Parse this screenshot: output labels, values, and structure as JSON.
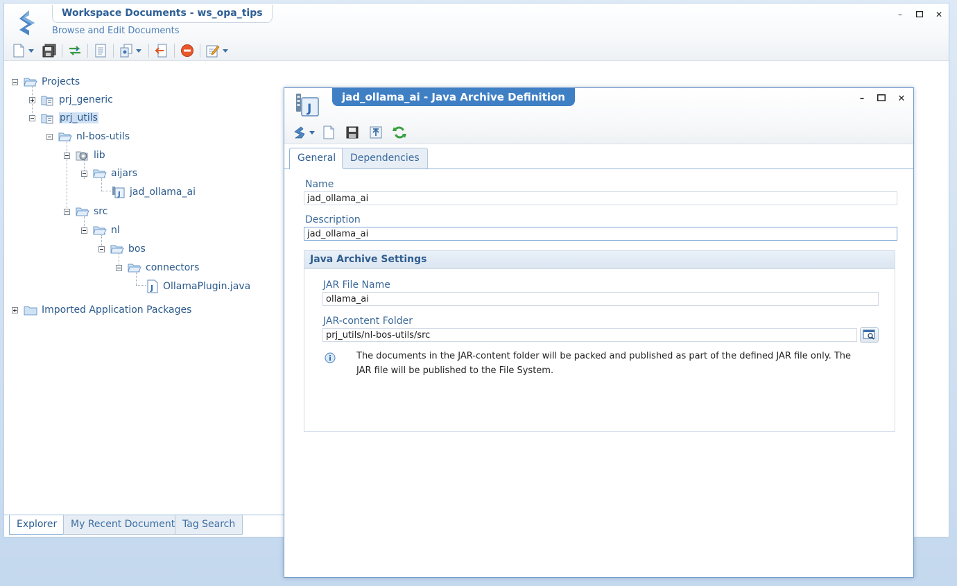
{
  "workspace": {
    "title": "Workspace Documents - ws_opa_tips",
    "subtitle": "Browse and Edit Documents"
  },
  "toolbar_icons": [
    "new-document-icon",
    "save-all-icon",
    "sync-icon",
    "document-icon",
    "copy-icon",
    "export-icon",
    "cancel-icon",
    "edit-icon"
  ],
  "tree": {
    "projects": "Projects",
    "prj_generic": "prj_generic",
    "prj_utils": "prj_utils",
    "nl_bos_utils": "nl-bos-utils",
    "lib": "lib",
    "aijars": "aijars",
    "jad_ollama_ai": "jad_ollama_ai",
    "src": "src",
    "nl": "nl",
    "bos": "bos",
    "connectors": "connectors",
    "ollama_plugin": "OllamaPlugin.java",
    "imported": "Imported Application Packages"
  },
  "bottom_tabs": {
    "explorer": "Explorer",
    "recent": "My Recent Documents",
    "tag_search": "Tag Search"
  },
  "dialog": {
    "title": "jad_ollama_ai - Java Archive Definition",
    "tabs": {
      "general": "General",
      "dependencies": "Dependencies"
    },
    "name_label": "Name",
    "name_value": "jad_ollama_ai",
    "description_label": "Description",
    "description_value": "jad_ollama_ai",
    "group_title": "Java Archive Settings",
    "jar_label": "JAR File Name",
    "jar_value": "ollama_ai",
    "folder_label": "JAR-content Folder",
    "folder_value": "prj_utils/nl-bos-utils/src",
    "info": "The documents in the JAR-content folder will be packed and published as part of the defined JAR file only. The JAR file will be published to the File System."
  },
  "colors": {
    "accent": "#3f7fc4",
    "link": "#2b5a8c",
    "selection": "#cfe0f3"
  }
}
